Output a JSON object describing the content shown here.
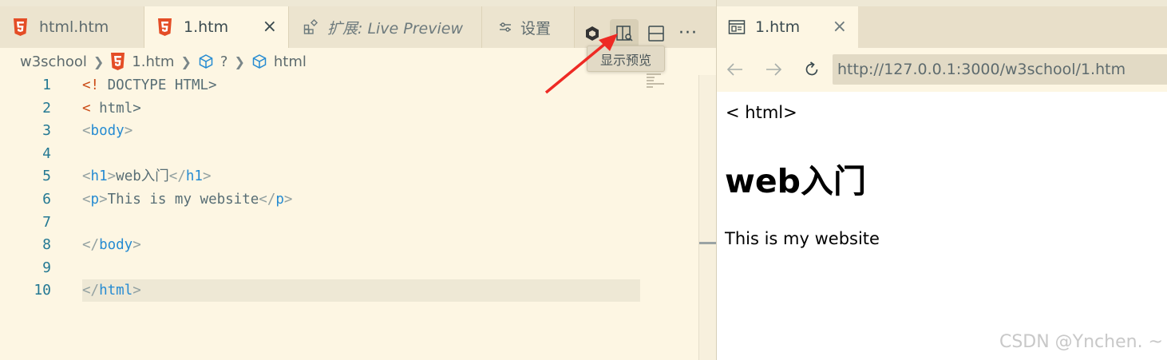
{
  "editor_tabs": [
    {
      "label": "html.htm"
    },
    {
      "label": "1.htm"
    },
    {
      "label": "扩展: Live Preview"
    },
    {
      "label": "设置"
    }
  ],
  "tooltip": "显示预览",
  "breadcrumb": {
    "folder": "w3school",
    "file": "1.htm",
    "symbol_unknown": "?",
    "symbol_html": "html"
  },
  "code_lines": [
    {
      "n": "1",
      "text": "<! DOCTYPE HTML>"
    },
    {
      "n": "2",
      "text": "< html>"
    },
    {
      "n": "3",
      "text": "<body>"
    },
    {
      "n": "4",
      "text": ""
    },
    {
      "n": "5",
      "text": "<h1>web入门</h1>"
    },
    {
      "n": "6",
      "text": "<p>This is my website</p>"
    },
    {
      "n": "7",
      "text": ""
    },
    {
      "n": "8",
      "text": "</body>"
    },
    {
      "n": "9",
      "text": ""
    },
    {
      "n": "10",
      "text": "</html>"
    }
  ],
  "code_tokens": {
    "l1_a": "<!",
    "l1_b": " DOCTYPE HTML>",
    "l2_a": "<",
    "l2_b": " html>",
    "l3_lt": "<",
    "l3_tag": "body",
    "l3_gt": ">",
    "l5_lt1": "<",
    "l5_tag1": "h1",
    "l5_gt1": ">",
    "l5_text": "web入门",
    "l5_lt2": "</",
    "l5_tag2": "h1",
    "l5_gt2": ">",
    "l6_lt1": "<",
    "l6_tag1": "p",
    "l6_gt1": ">",
    "l6_text": "This is my website",
    "l6_lt2": "</",
    "l6_tag2": "p",
    "l6_gt2": ">",
    "l8_lt": "</",
    "l8_tag": "body",
    "l8_gt": ">",
    "l10_lt": "</",
    "l10_tag": "html",
    "l10_gt": ">"
  },
  "preview": {
    "tab_label": "1.htm",
    "url": "http://127.0.0.1:3000/w3school/1.htm",
    "content_line1": "< html>",
    "heading": "web入门",
    "paragraph": "This is my website"
  },
  "watermark": "CSDN @Ynchen. ~",
  "colors": {
    "editor_bg": "#fdf6e3",
    "tab_bar": "#e8dfc9",
    "html5_icon": "#e44d26",
    "tag_blue": "#268bd2",
    "line_number": "#237893",
    "annotation_arrow": "#ee2a24"
  },
  "icons": [
    "html5-icon",
    "close-icon",
    "extension-icon",
    "settings-sliders-icon",
    "copilot-icon",
    "open-preview-icon",
    "split-editor-icon",
    "more-actions-icon",
    "chevron-right-icon",
    "symbol-cube-icon",
    "browser-tab-icon",
    "back-arrow-icon",
    "forward-arrow-icon",
    "reload-icon",
    "red-pointer-arrow"
  ]
}
